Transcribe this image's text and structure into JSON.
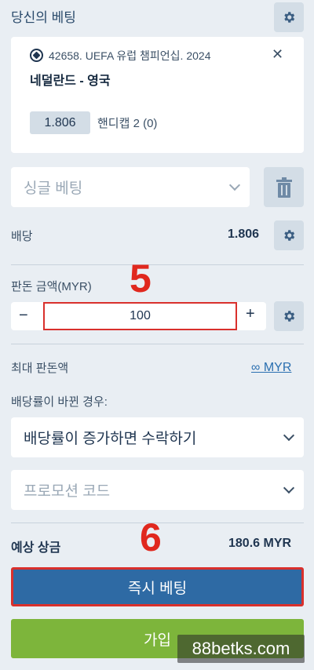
{
  "header": {
    "title": "당신의 베팅"
  },
  "bet": {
    "event": "42658. UEFA 유럽 챔피언십. 2024",
    "match": "네덜란드 - 영국",
    "odds": "1.806",
    "market": "핸디캡 2 (0)",
    "close_symbol": "✕"
  },
  "bet_type": {
    "selected": "싱글 베팅"
  },
  "odds_row": {
    "label": "배당",
    "value": "1.806"
  },
  "stake": {
    "label": "판돈 금액(MYR)",
    "minus": "−",
    "plus": "+",
    "value": "100",
    "step_marker": "5"
  },
  "max_stake": {
    "label": "최대 판돈액",
    "value": "∞ MYR"
  },
  "odds_change": {
    "label": "배당률이 바뀐 경우:",
    "selected": "배당률이 증가하면 수락하기"
  },
  "promo": {
    "placeholder": "프로모션 코드"
  },
  "payout": {
    "label": "예상 상금",
    "value": "180.6 MYR",
    "step_marker": "6"
  },
  "actions": {
    "place_bet": "즉시 베팅",
    "join": "가입"
  },
  "watermark": "88betks.com",
  "colors": {
    "primary": "#2e6aa4",
    "join": "#7db53b",
    "highlight": "#d9302c",
    "background": "#e9eef3"
  }
}
